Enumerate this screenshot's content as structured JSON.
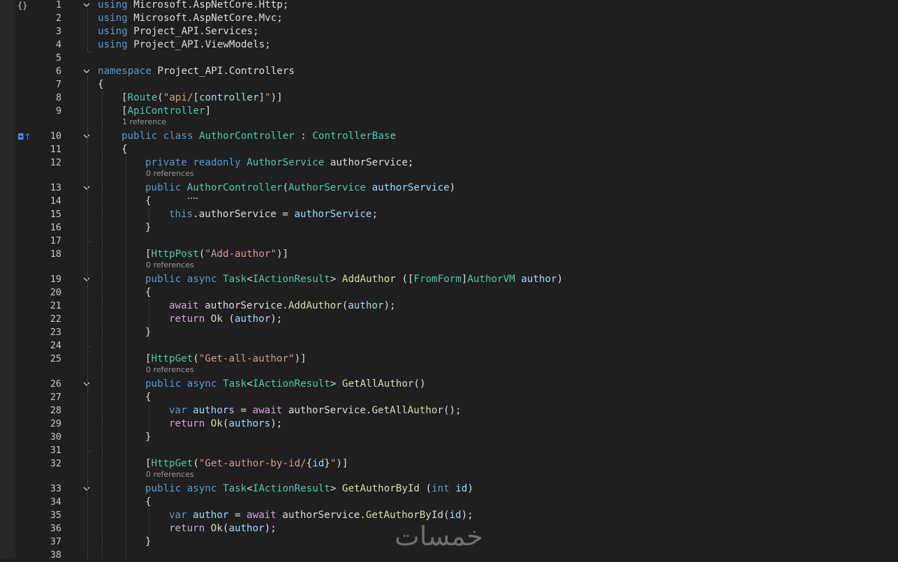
{
  "editor": {
    "lines": [
      {
        "n": "1",
        "fold": true,
        "indent": 0,
        "tokens": [
          [
            "kw",
            "using"
          ],
          [
            "pl",
            " Microsoft.AspNetCore.Http;"
          ]
        ]
      },
      {
        "n": "2",
        "indent": 0,
        "tokens": [
          [
            "kw",
            "using"
          ],
          [
            "pl",
            " Microsoft.AspNetCore.Mvc;"
          ]
        ]
      },
      {
        "n": "3",
        "indent": 0,
        "tokens": [
          [
            "kw",
            "using"
          ],
          [
            "pl",
            " Project_API.Services;"
          ]
        ]
      },
      {
        "n": "4",
        "indent": 0,
        "tokens": [
          [
            "kw",
            "using"
          ],
          [
            "pl",
            " Project_API.ViewModels;"
          ]
        ]
      },
      {
        "n": "5",
        "indent": 0,
        "tokens": []
      },
      {
        "n": "6",
        "fold": true,
        "indent": 0,
        "tokens": [
          [
            "kw",
            "namespace"
          ],
          [
            "pl",
            " Project_API.Controllers"
          ]
        ]
      },
      {
        "n": "7",
        "indent": 0,
        "tokens": [
          [
            "pl",
            "{"
          ]
        ]
      },
      {
        "n": "8",
        "indent": 1,
        "tokens": [
          [
            "pl",
            "["
          ],
          [
            "type",
            "Route"
          ],
          [
            "pl",
            "("
          ],
          [
            "str",
            "\"api/"
          ],
          [
            "par",
            "[controller]"
          ],
          [
            "str",
            "\""
          ],
          [
            "pl",
            ")]"
          ]
        ]
      },
      {
        "n": "9",
        "indent": 1,
        "tokens": [
          [
            "pl",
            "["
          ],
          [
            "type",
            "ApiController"
          ],
          [
            "pl",
            "]"
          ]
        ],
        "lens": "1 reference"
      },
      {
        "n": "10",
        "fold": true,
        "indent": 1,
        "tokens": [
          [
            "kw",
            "public"
          ],
          [
            "pl",
            " "
          ],
          [
            "kw",
            "class"
          ],
          [
            "pl",
            " "
          ],
          [
            "type",
            "AuthorController"
          ],
          [
            "pl",
            " : "
          ],
          [
            "type",
            "ControllerBase"
          ]
        ]
      },
      {
        "n": "11",
        "indent": 1,
        "tokens": [
          [
            "pl",
            "{"
          ]
        ]
      },
      {
        "n": "12",
        "indent": 2,
        "tokens": [
          [
            "kw",
            "private"
          ],
          [
            "pl",
            " "
          ],
          [
            "kw",
            "readonly"
          ],
          [
            "pl",
            " "
          ],
          [
            "type",
            "AuthorService"
          ],
          [
            "pl",
            " authorService;"
          ]
        ],
        "lens": "0 references"
      },
      {
        "n": "13",
        "fold": true,
        "indent": 2,
        "tokens": [
          [
            "kw",
            "public"
          ],
          [
            "pl",
            " "
          ],
          [
            "type",
            "AuthorController"
          ],
          [
            "pl",
            "("
          ],
          [
            "type",
            "AuthorService"
          ],
          [
            "pl",
            " "
          ],
          [
            "par",
            "authorService"
          ],
          [
            "pl",
            ")"
          ]
        ]
      },
      {
        "n": "14",
        "indent": 2,
        "tokens": [
          [
            "pl",
            "{"
          ]
        ]
      },
      {
        "n": "15",
        "indent": 3,
        "tokens": [
          [
            "kw",
            "this"
          ],
          [
            "pl",
            ".authorService = "
          ],
          [
            "par",
            "authorService"
          ],
          [
            "pl",
            ";"
          ]
        ]
      },
      {
        "n": "16",
        "indent": 2,
        "tokens": [
          [
            "pl",
            "}"
          ]
        ]
      },
      {
        "n": "17",
        "indent": 2,
        "tokens": []
      },
      {
        "n": "18",
        "indent": 2,
        "tokens": [
          [
            "pl",
            "["
          ],
          [
            "type",
            "HttpPost"
          ],
          [
            "pl",
            "("
          ],
          [
            "str",
            "\"Add-author\""
          ],
          [
            "pl",
            ")]"
          ]
        ],
        "lens": "0 references"
      },
      {
        "n": "19",
        "fold": true,
        "indent": 2,
        "tokens": [
          [
            "kw",
            "public"
          ],
          [
            "pl",
            " "
          ],
          [
            "kw",
            "async"
          ],
          [
            "pl",
            " "
          ],
          [
            "type",
            "Task"
          ],
          [
            "pl",
            "<"
          ],
          [
            "type",
            "IActionResult"
          ],
          [
            "pl",
            "> "
          ],
          [
            "fn",
            "AddAuthor"
          ],
          [
            "pl",
            " (["
          ],
          [
            "type",
            "FromForm"
          ],
          [
            "pl",
            "]"
          ],
          [
            "type",
            "AuthorVM"
          ],
          [
            "pl",
            " "
          ],
          [
            "par",
            "author"
          ],
          [
            "pl",
            ")"
          ]
        ]
      },
      {
        "n": "20",
        "indent": 2,
        "tokens": [
          [
            "pl",
            "{"
          ]
        ]
      },
      {
        "n": "21",
        "indent": 3,
        "tokens": [
          [
            "ctl",
            "await"
          ],
          [
            "pl",
            " authorService."
          ],
          [
            "fn",
            "AddAuthor"
          ],
          [
            "pl",
            "("
          ],
          [
            "par",
            "author"
          ],
          [
            "pl",
            ");"
          ]
        ]
      },
      {
        "n": "22",
        "indent": 3,
        "tokens": [
          [
            "ctl",
            "return"
          ],
          [
            "pl",
            " "
          ],
          [
            "fn",
            "Ok"
          ],
          [
            "pl",
            " ("
          ],
          [
            "par",
            "author"
          ],
          [
            "pl",
            ");"
          ]
        ]
      },
      {
        "n": "23",
        "indent": 2,
        "tokens": [
          [
            "pl",
            "}"
          ]
        ]
      },
      {
        "n": "24",
        "indent": 2,
        "tokens": []
      },
      {
        "n": "25",
        "indent": 2,
        "tokens": [
          [
            "pl",
            "["
          ],
          [
            "type",
            "HttpGet"
          ],
          [
            "pl",
            "("
          ],
          [
            "str",
            "\"Get-all-author\""
          ],
          [
            "pl",
            ")]"
          ]
        ],
        "lens": "0 references"
      },
      {
        "n": "26",
        "fold": true,
        "indent": 2,
        "tokens": [
          [
            "kw",
            "public"
          ],
          [
            "pl",
            " "
          ],
          [
            "kw",
            "async"
          ],
          [
            "pl",
            " "
          ],
          [
            "type",
            "Task"
          ],
          [
            "pl",
            "<"
          ],
          [
            "type",
            "IActionResult"
          ],
          [
            "pl",
            "> "
          ],
          [
            "fn",
            "GetAllAuthor"
          ],
          [
            "pl",
            "()"
          ]
        ]
      },
      {
        "n": "27",
        "indent": 2,
        "tokens": [
          [
            "pl",
            "{"
          ]
        ]
      },
      {
        "n": "28",
        "indent": 3,
        "tokens": [
          [
            "kw",
            "var"
          ],
          [
            "pl",
            " "
          ],
          [
            "par",
            "authors"
          ],
          [
            "pl",
            " = "
          ],
          [
            "ctl",
            "await"
          ],
          [
            "pl",
            " authorService."
          ],
          [
            "fn",
            "GetAllAuthor"
          ],
          [
            "pl",
            "();"
          ]
        ]
      },
      {
        "n": "29",
        "indent": 3,
        "tokens": [
          [
            "ctl",
            "return"
          ],
          [
            "pl",
            " "
          ],
          [
            "fn",
            "Ok"
          ],
          [
            "pl",
            "("
          ],
          [
            "par",
            "authors"
          ],
          [
            "pl",
            ");"
          ]
        ]
      },
      {
        "n": "30",
        "indent": 2,
        "tokens": [
          [
            "pl",
            "}"
          ]
        ]
      },
      {
        "n": "31",
        "indent": 2,
        "tokens": []
      },
      {
        "n": "32",
        "indent": 2,
        "tokens": [
          [
            "pl",
            "["
          ],
          [
            "type",
            "HttpGet"
          ],
          [
            "pl",
            "("
          ],
          [
            "str",
            "\"Get-author-by-id/"
          ],
          [
            "pl",
            "{"
          ],
          [
            "par",
            "id"
          ],
          [
            "pl",
            "}"
          ],
          [
            "str",
            "\""
          ],
          [
            "pl",
            ")]"
          ]
        ],
        "lens": "0 references"
      },
      {
        "n": "33",
        "fold": true,
        "indent": 2,
        "tokens": [
          [
            "kw",
            "public"
          ],
          [
            "pl",
            " "
          ],
          [
            "kw",
            "async"
          ],
          [
            "pl",
            " "
          ],
          [
            "type",
            "Task"
          ],
          [
            "pl",
            "<"
          ],
          [
            "type",
            "IActionResult"
          ],
          [
            "pl",
            "> "
          ],
          [
            "fn",
            "GetAuthorById"
          ],
          [
            "pl",
            " ("
          ],
          [
            "kw",
            "int"
          ],
          [
            "pl",
            " "
          ],
          [
            "par",
            "id"
          ],
          [
            "pl",
            ")"
          ]
        ]
      },
      {
        "n": "34",
        "indent": 2,
        "tokens": [
          [
            "pl",
            "{"
          ]
        ]
      },
      {
        "n": "35",
        "indent": 3,
        "tokens": [
          [
            "kw",
            "var"
          ],
          [
            "pl",
            " "
          ],
          [
            "par",
            "author"
          ],
          [
            "pl",
            " = "
          ],
          [
            "ctl",
            "await"
          ],
          [
            "pl",
            " authorService."
          ],
          [
            "fn",
            "GetAuthorById"
          ],
          [
            "pl",
            "("
          ],
          [
            "par",
            "id"
          ],
          [
            "pl",
            ");"
          ]
        ]
      },
      {
        "n": "36",
        "indent": 3,
        "tokens": [
          [
            "ctl",
            "return"
          ],
          [
            "pl",
            " "
          ],
          [
            "fn",
            "Ok"
          ],
          [
            "pl",
            "("
          ],
          [
            "par",
            "author"
          ],
          [
            "pl",
            ");"
          ]
        ]
      },
      {
        "n": "37",
        "indent": 2,
        "tokens": [
          [
            "pl",
            "}"
          ]
        ]
      },
      {
        "n": "38",
        "indent": 2,
        "tokens": []
      }
    ]
  },
  "glyphs": {
    "brace_icon": "{}",
    "bookmark_icon": "◘↑"
  },
  "watermark": {
    "text": "خمسات"
  },
  "colors": {
    "background": "#1f1f1f",
    "keyword": "#569cd6",
    "control": "#d8a0df",
    "type": "#4ec9b0",
    "string": "#d69d85",
    "parameter": "#9cdcfe",
    "method": "#dcdcaa",
    "plain": "#dcdcdc"
  }
}
